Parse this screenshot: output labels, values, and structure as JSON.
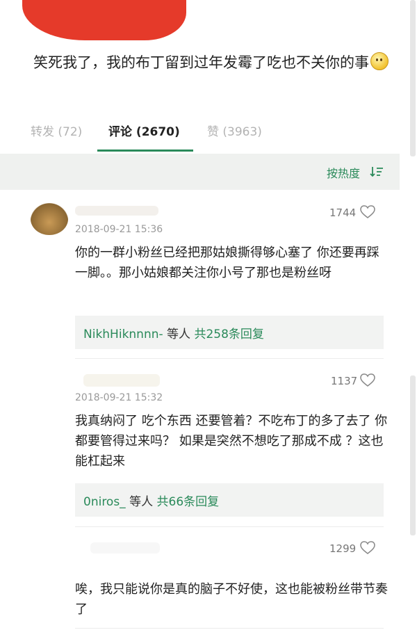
{
  "post": {
    "text": "笑死我了，我的布丁留到过年发霉了吃也不关你的事"
  },
  "tabs": [
    {
      "label": "转发 (72)"
    },
    {
      "label": "评论 (2670)"
    },
    {
      "label": "赞 (3963)"
    }
  ],
  "sort": {
    "label": "按热度"
  },
  "comments": [
    {
      "likes": "1744",
      "time": "2018-09-21 15:36",
      "text": "你的一群小粉丝已经把那姑娘撕得够心塞了 你还要再踩一脚。。那小姑娘都关注你小号了那也是粉丝呀",
      "reply": {
        "user": "NikhHiknnnn-",
        "mid": " 等人 ",
        "count": "共258条回复"
      }
    },
    {
      "likes": "1137",
      "time": "2018-09-21 15:32",
      "text": "我真纳闷了  吃个东西  还要管着？不吃布丁的多了去了  你都要管得过来吗？  如果是突然不想吃了那成不成 ？这也能杠起来",
      "reply": {
        "user": "0niros_",
        "mid": " 等人 ",
        "count": "共66条回复"
      }
    },
    {
      "likes": "1299",
      "text": "唉，我只能说你是真的脑子不好使，这也能被粉丝带节奏了"
    }
  ],
  "icons": {
    "like": "heart-icon",
    "sort": "sort-desc-icon"
  },
  "colors": {
    "accent": "#2a8a5a",
    "redaction": "#e53a2a"
  }
}
